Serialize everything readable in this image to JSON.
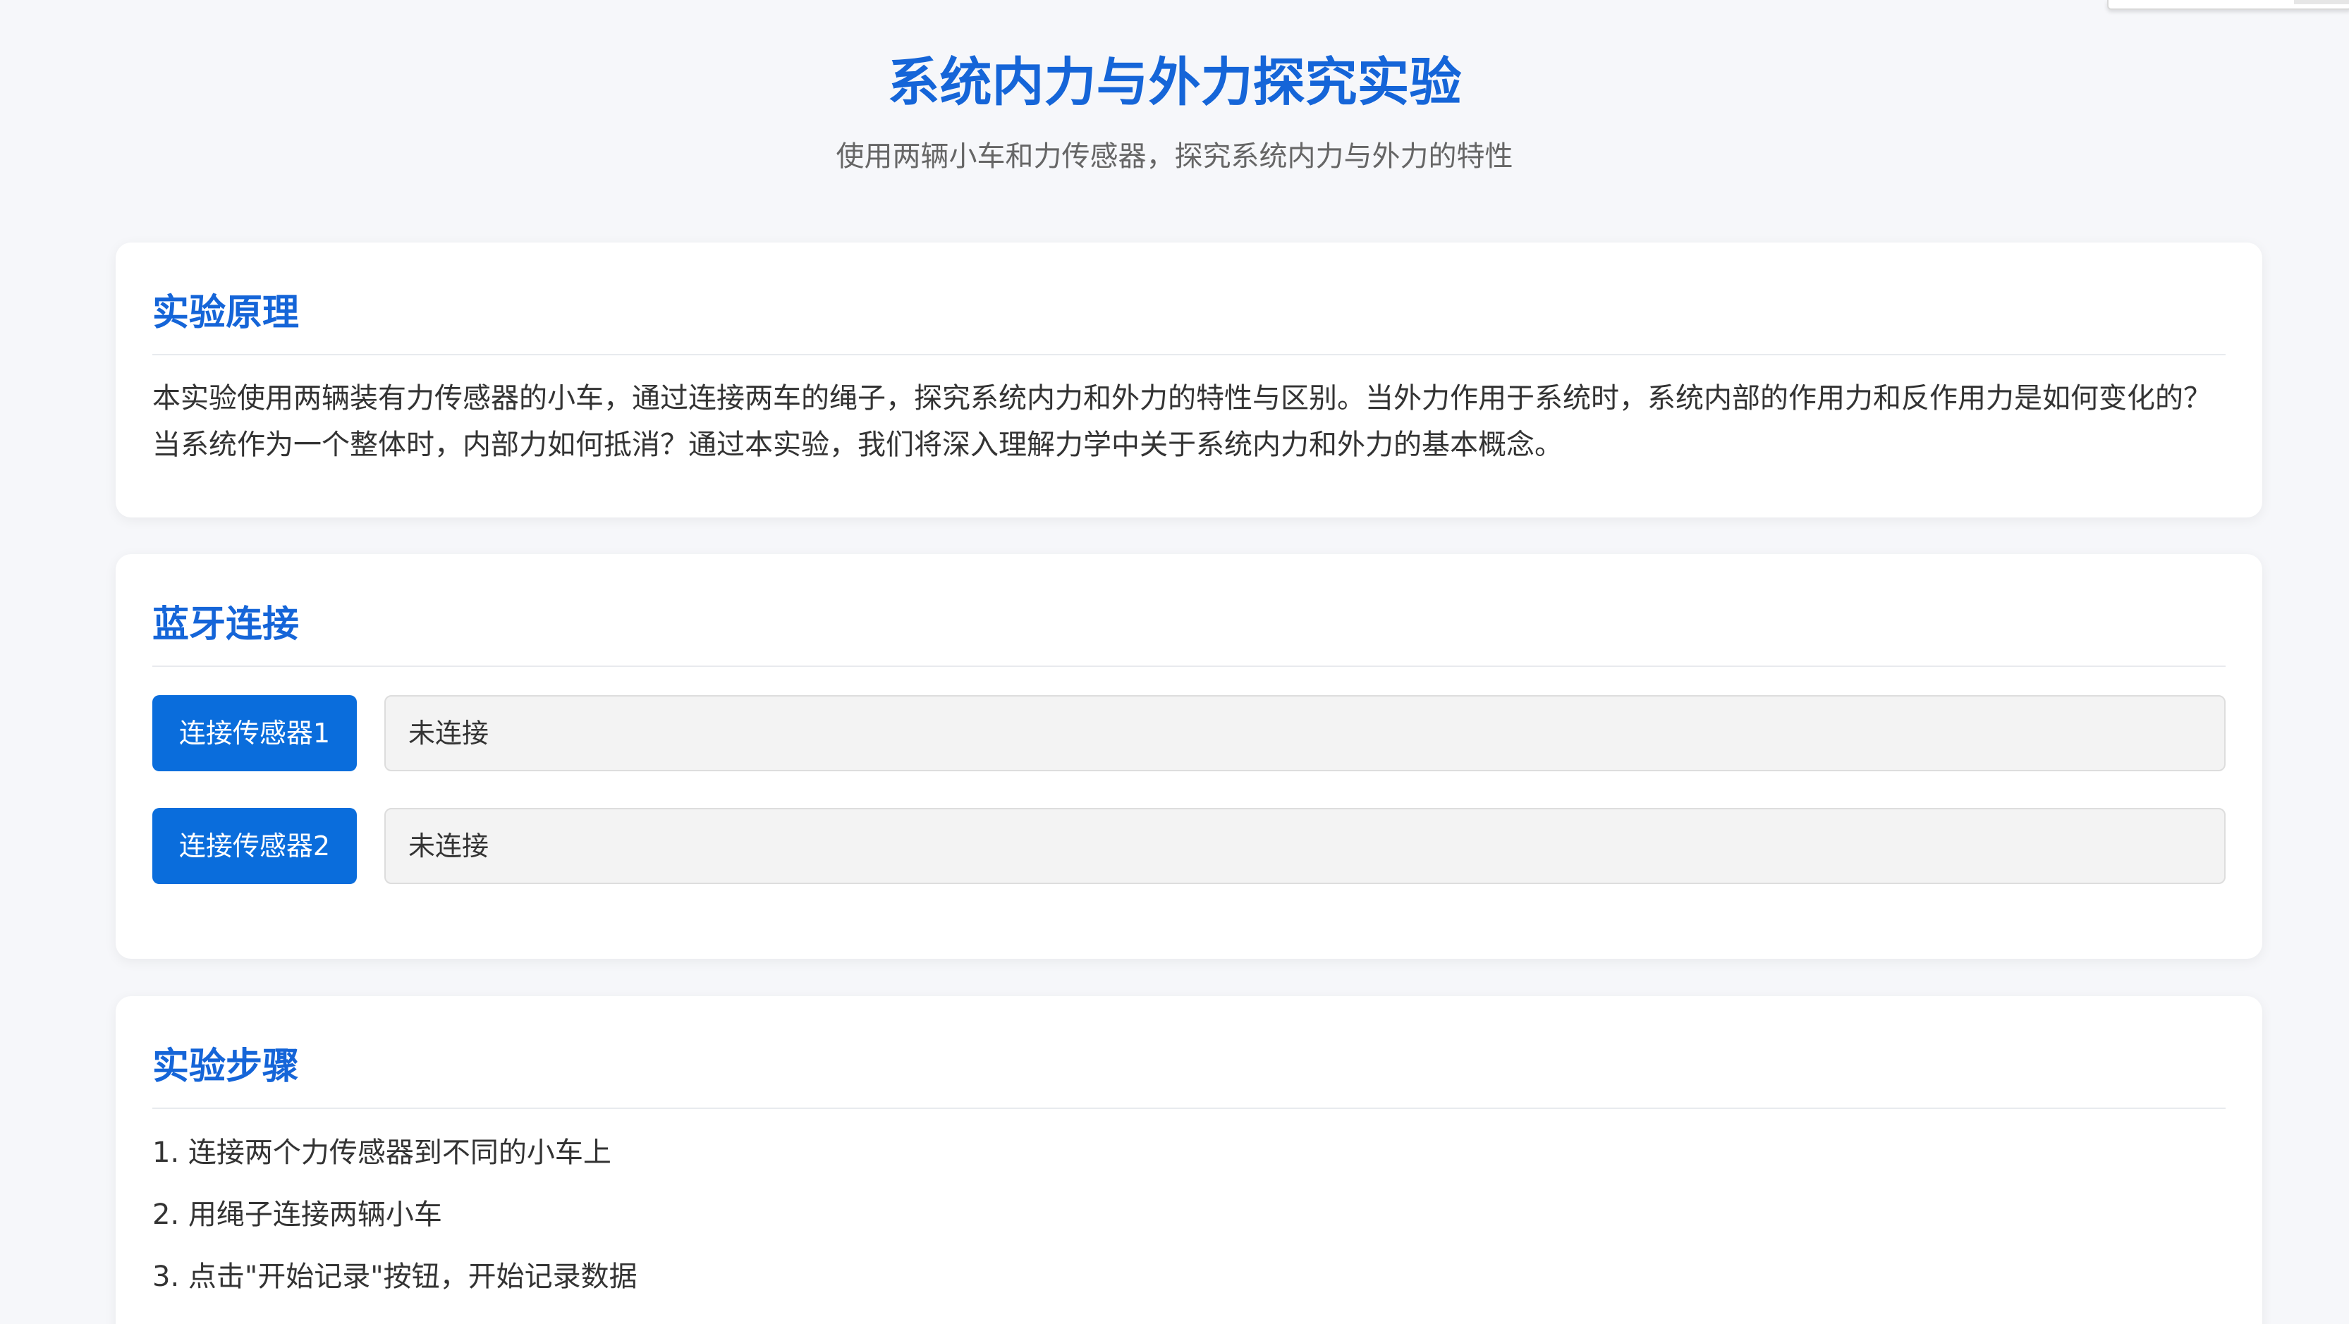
{
  "header": {
    "title": "系统内力与外力探究实验",
    "subtitle": "使用两辆小车和力传感器，探究系统内力与外力的特性"
  },
  "principle": {
    "title": "实验原理",
    "text": "本实验使用两辆装有力传感器的小车，通过连接两车的绳子，探究系统内力和外力的特性与区别。当外力作用于系统时，系统内部的作用力和反作用力是如何变化的？当系统作为一个整体时，内部力如何抵消？通过本实验，我们将深入理解力学中关于系统内力和外力的基本概念。"
  },
  "bluetooth": {
    "title": "蓝牙连接",
    "sensors": [
      {
        "button_label": "连接传感器1",
        "status": "未连接"
      },
      {
        "button_label": "连接传感器2",
        "status": "未连接"
      }
    ]
  },
  "steps": {
    "title": "实验步骤",
    "items": [
      "1. 连接两个力传感器到不同的小车上",
      "2. 用绳子连接两辆小车",
      "3. 点击\"开始记录\"按钮，开始记录数据"
    ]
  },
  "colors": {
    "accent": "#1565d8",
    "button": "#0a6ddc",
    "background": "#f6f7fa"
  }
}
